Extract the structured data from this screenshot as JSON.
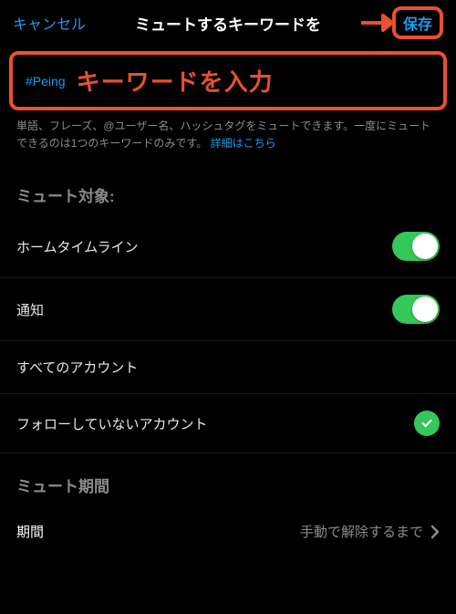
{
  "header": {
    "cancel": "キャンセル",
    "title": "ミュートするキーワードを",
    "save": "保存"
  },
  "input": {
    "value": "#Peing",
    "annotation": "キーワードを入力"
  },
  "hint": {
    "text": "単語、フレーズ、@ユーザー名、ハッシュタグをミュートできます。一度にミュートできるのは1つのキーワードのみです。",
    "link": "詳細はこちら"
  },
  "sections": {
    "target": {
      "header": "ミュート対象:",
      "rows": {
        "home_timeline": "ホームタイムライン",
        "notifications": "通知",
        "all_accounts": "すべてのアカウント",
        "not_following": "フォローしていないアカウント"
      }
    },
    "duration": {
      "header": "ミュート期間",
      "label": "期間",
      "value": "手動で解除するまで"
    }
  },
  "colors": {
    "accent": "#1d9bf0",
    "highlight": "#e8512f",
    "switch_on": "#34c759"
  }
}
